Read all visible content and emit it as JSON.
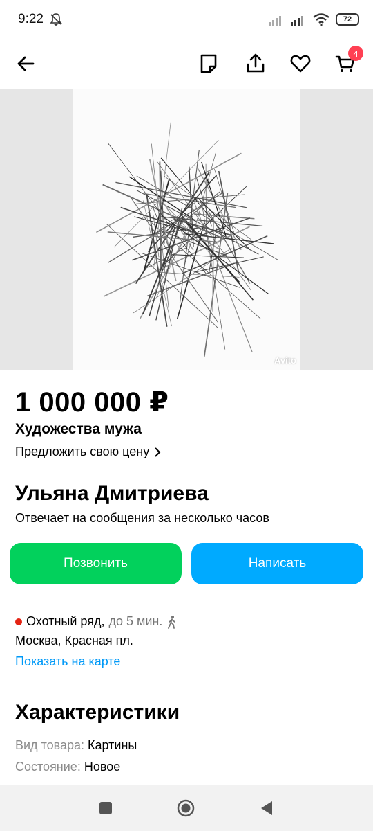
{
  "status_bar": {
    "time": "9:22",
    "battery": "72"
  },
  "top_bar": {
    "cart_count": "4",
    "icons": [
      "back-arrow-icon",
      "note-icon",
      "share-icon",
      "heart-icon",
      "cart-icon"
    ]
  },
  "gallery": {
    "watermark": "Avito"
  },
  "listing": {
    "price": "1 000 000 ₽",
    "title": "Художества мужа",
    "offer_price": "Предложить свою цену"
  },
  "seller": {
    "name": "Ульяна Дмитриева",
    "reply_time": "Отвечает на сообщения за несколько часов"
  },
  "actions": {
    "call": "Позвонить",
    "message": "Написать"
  },
  "location": {
    "metro": "Охотный ряд,",
    "walk_time": "до 5 мин.",
    "address": "Москва, Красная пл.",
    "map_link": "Показать на карте"
  },
  "specs": {
    "heading": "Характеристики",
    "rows": [
      {
        "key": "Вид товара:",
        "value": "Картины"
      },
      {
        "key": "Состояние:",
        "value": "Новое"
      }
    ]
  },
  "colors": {
    "call_green": "#02d15c",
    "message_blue": "#00aaff",
    "link_blue": "#0099f7",
    "badge_red": "#ff4053",
    "metro_red": "#e42313"
  }
}
